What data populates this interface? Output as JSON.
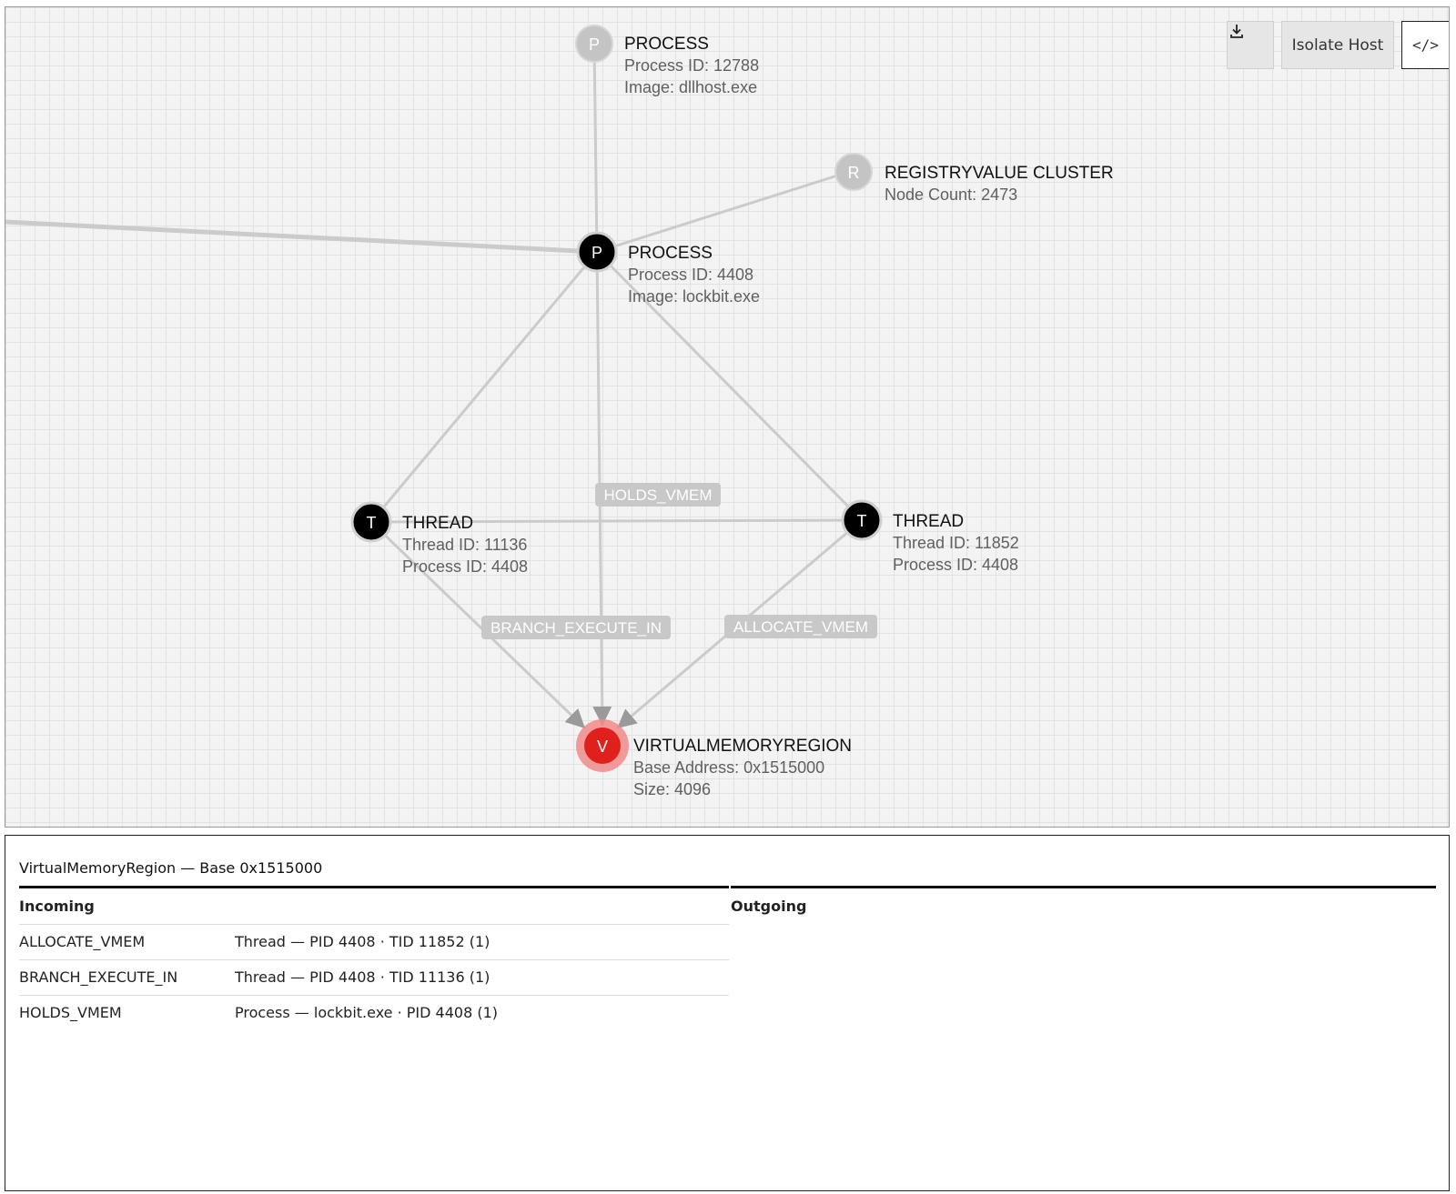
{
  "toolbar": {
    "download_icon": "download-icon",
    "isolate_label": "Isolate Host",
    "code_label": "</>"
  },
  "graph": {
    "nodes": [
      {
        "glyph": "P",
        "title": "PROCESS",
        "lines": [
          "Process ID: 12788",
          "Image: dllhost.exe"
        ],
        "style": "faded"
      },
      {
        "glyph": "R",
        "title": "REGISTRYVALUE CLUSTER",
        "lines": [
          "Node Count: 2473"
        ],
        "style": "faded"
      },
      {
        "glyph": "P",
        "title": "PROCESS",
        "lines": [
          "Process ID: 4408",
          "Image: lockbit.exe"
        ],
        "style": "dark"
      },
      {
        "glyph": "T",
        "title": "THREAD",
        "lines": [
          "Thread ID: 11136",
          "Process ID: 4408"
        ],
        "style": "dark"
      },
      {
        "glyph": "T",
        "title": "THREAD",
        "lines": [
          "Thread ID: 11852",
          "Process ID: 4408"
        ],
        "style": "dark"
      },
      {
        "glyph": "V",
        "title": "VIRTUALMEMORYREGION",
        "lines": [
          "Base Address: 0x1515000",
          "Size: 4096"
        ],
        "style": "selected"
      }
    ],
    "edge_labels": [
      "HOLDS_VMEM",
      "BRANCH_EXECUTE_IN",
      "ALLOCATE_VMEM"
    ],
    "colors": {
      "selected": "#e0201c",
      "dark": "#000000",
      "faded": "#c4c4c4",
      "edge": "#cbcbcb"
    }
  },
  "details": {
    "title": "VirtualMemoryRegion — Base 0x1515000",
    "incoming_label": "Incoming",
    "outgoing_label": "Outgoing",
    "incoming": [
      {
        "relation": "ALLOCATE_VMEM",
        "target": "Thread — PID 4408 · TID 11852 (1)"
      },
      {
        "relation": "BRANCH_EXECUTE_IN",
        "target": "Thread — PID 4408 · TID 11136 (1)"
      },
      {
        "relation": "HOLDS_VMEM",
        "target": "Process — lockbit.exe · PID 4408 (1)"
      }
    ],
    "outgoing": []
  }
}
